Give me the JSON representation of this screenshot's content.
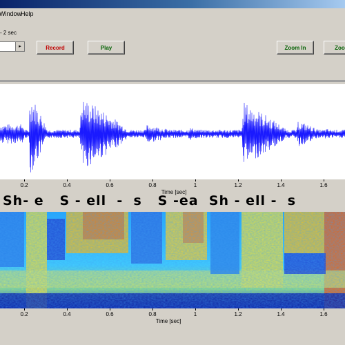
{
  "menu": {
    "window": "Window",
    "help": "Help"
  },
  "controls": {
    "duration_label": "- 2 sec",
    "combo_arrow": "▸",
    "record": "Record",
    "play": "Play",
    "zoom_in": "Zoom In",
    "zoom_out": "Zoom"
  },
  "waveform": {
    "x_ticks": [
      "0.2",
      "0.4",
      "0.6",
      "0.8",
      "1",
      "1.2",
      "1.4",
      "1.6"
    ],
    "x_title": "Time [sec]",
    "color": "#1a1aff"
  },
  "lyrics": "Sh- e   S - ell  -  s   S -ea  Sh - ell -  s",
  "spectrogram": {
    "x_ticks": [
      "0.2",
      "0.4",
      "0.6",
      "0.8",
      "1",
      "1.2",
      "1.4",
      "1.6"
    ],
    "x_title": "Time [sec]",
    "colormap": "jet"
  }
}
